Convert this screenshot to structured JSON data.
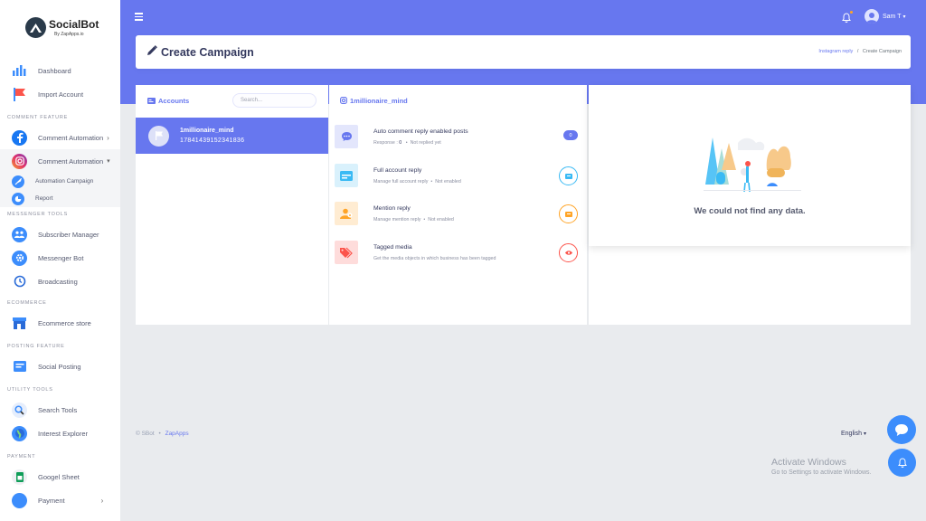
{
  "brand": {
    "name": "SocialBot",
    "sub": "By ZapApps.io"
  },
  "sidebar": {
    "items": [
      {
        "label": "Dashboard"
      },
      {
        "label": "Import Account"
      }
    ],
    "comment_header": "COMMENT FEATURE",
    "comment_items": [
      {
        "label": "Comment Automation"
      },
      {
        "label": "Comment Automation"
      }
    ],
    "submenu": [
      {
        "label": "Automation Campaign"
      },
      {
        "label": "Report"
      }
    ],
    "messenger_header": "MESSENGER TOOLS",
    "messenger_items": [
      {
        "label": "Subscriber Manager"
      },
      {
        "label": "Messenger Bot"
      },
      {
        "label": "Broadcasting"
      }
    ],
    "ecommerce_header": "ECOMMERCE",
    "ecommerce_items": [
      {
        "label": "Ecommerce store"
      }
    ],
    "posting_header": "POSTING FEATURE",
    "posting_items": [
      {
        "label": "Social Posting"
      }
    ],
    "utility_header": "UTILITY TOOLS",
    "utility_items": [
      {
        "label": "Search Tools"
      },
      {
        "label": "Interest Explorer"
      }
    ],
    "payment_header": "PAYMENT",
    "payment_items": [
      {
        "label": "Googel Sheet"
      },
      {
        "label": "Payment"
      }
    ]
  },
  "topbar": {
    "user_name": "Sam T"
  },
  "page": {
    "title": "Create Campaign",
    "breadcrumb_link": "Instagram reply",
    "breadcrumb_sep": "/",
    "breadcrumb_current": "Create Campaign"
  },
  "accounts": {
    "label": "Accounts",
    "search_placeholder": "Search...",
    "selected": {
      "name": "1millionaire_mind",
      "id": "17841439152341836"
    }
  },
  "options": {
    "header": "1millionaire_mind",
    "header_icon": "instagram-icon",
    "rows": [
      {
        "title": "Auto comment reply enabled posts",
        "sub_prefix": "Response : ",
        "sub_value": "0",
        "sub_status": "Not replied yet",
        "badge": "0",
        "icon": "chat-icon",
        "color": "#6777ef",
        "bg": "#e3e6fc"
      },
      {
        "title": "Full account reply",
        "sub": "Manage full account reply",
        "sub_status": "Not enabled",
        "icon": "card-icon",
        "color": "#3abaf4",
        "bg": "#d9f1fc"
      },
      {
        "title": "Mention reply",
        "sub": "Manage mention reply",
        "sub_status": "Not enabled",
        "icon": "user-icon",
        "color": "#ffa426",
        "bg": "#ffecd2"
      },
      {
        "title": "Tagged media",
        "sub": "Get the media objects in which business has been tagged",
        "icon": "tag-icon",
        "color": "#fc544b",
        "bg": "#fedcdb"
      }
    ]
  },
  "empty": {
    "message": "We could not find any data."
  },
  "footer": {
    "copyright": "© SBot",
    "bullet": "•",
    "link": "ZapApps",
    "language": "English"
  },
  "watermark": {
    "line1": "Activate Windows",
    "line2": "Go to Settings to activate Windows."
  },
  "colors": {
    "primary": "#6777ef",
    "fab": "#3c8dfc"
  }
}
